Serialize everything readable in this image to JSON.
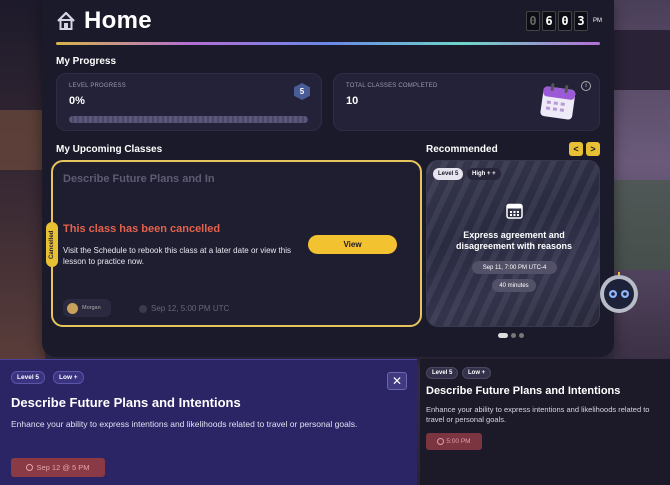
{
  "header": {
    "title": "Home",
    "clock_digits": [
      "0",
      "6",
      "0",
      "3"
    ],
    "ampm": "PM"
  },
  "progress": {
    "heading": "My Progress",
    "level_label": "LEVEL PROGRESS",
    "level_value": "0%",
    "level_fill": 0,
    "level_badge": "5",
    "total_label": "TOTAL CLASSES COMPLETED",
    "total_value": "10",
    "info_glyph": "i"
  },
  "upcoming": {
    "heading": "My Upcoming Classes",
    "faded_title": "Describe Future Plans and In",
    "cancelled_tag": "Cancelled",
    "cancel_message": "This class has been cancelled",
    "cancel_sub": "Visit the Schedule to rebook this class at a later date or view this lesson to practice now.",
    "view_button": "View",
    "teacher": "Morgan",
    "date": "Sep 12, 5:00 PM UTC"
  },
  "recommended": {
    "heading": "Recommended",
    "prev_glyph": "<",
    "next_glyph": ">",
    "tags": [
      "Level 5",
      "High + +"
    ],
    "title_line1": "Express agreement and",
    "title_line2": "disagreement with reasons",
    "date": "Sep 11, 7:00 PM UTC-4",
    "duration": "40 minutes",
    "page_count": 3,
    "active_page": 1
  },
  "modal": {
    "tags": [
      "Level 5",
      "Low +"
    ],
    "close_glyph": "✕",
    "title": "Describe Future Plans and Intentions",
    "description": "Enhance your ability to express intentions and likelihoods related to travel or personal goals.",
    "date": "Sep 12 @ 5 PM"
  },
  "side_card": {
    "tags": [
      "Level 5",
      "Low +"
    ],
    "title": "Describe Future Plans and Intentions",
    "description": "Enhance your ability to express intentions and likelihoods related to travel or personal goals.",
    "date": "5:00 PM"
  },
  "colors": {
    "accent": "#e8c033",
    "cancel": "#e3624b",
    "modal_bg": "#2b2465",
    "panel_bg": "#1b1a2b"
  },
  "icons": [
    "home-icon",
    "calendar-icon",
    "info-icon",
    "clock-icon",
    "close-icon",
    "robot-assistant-icon"
  ]
}
